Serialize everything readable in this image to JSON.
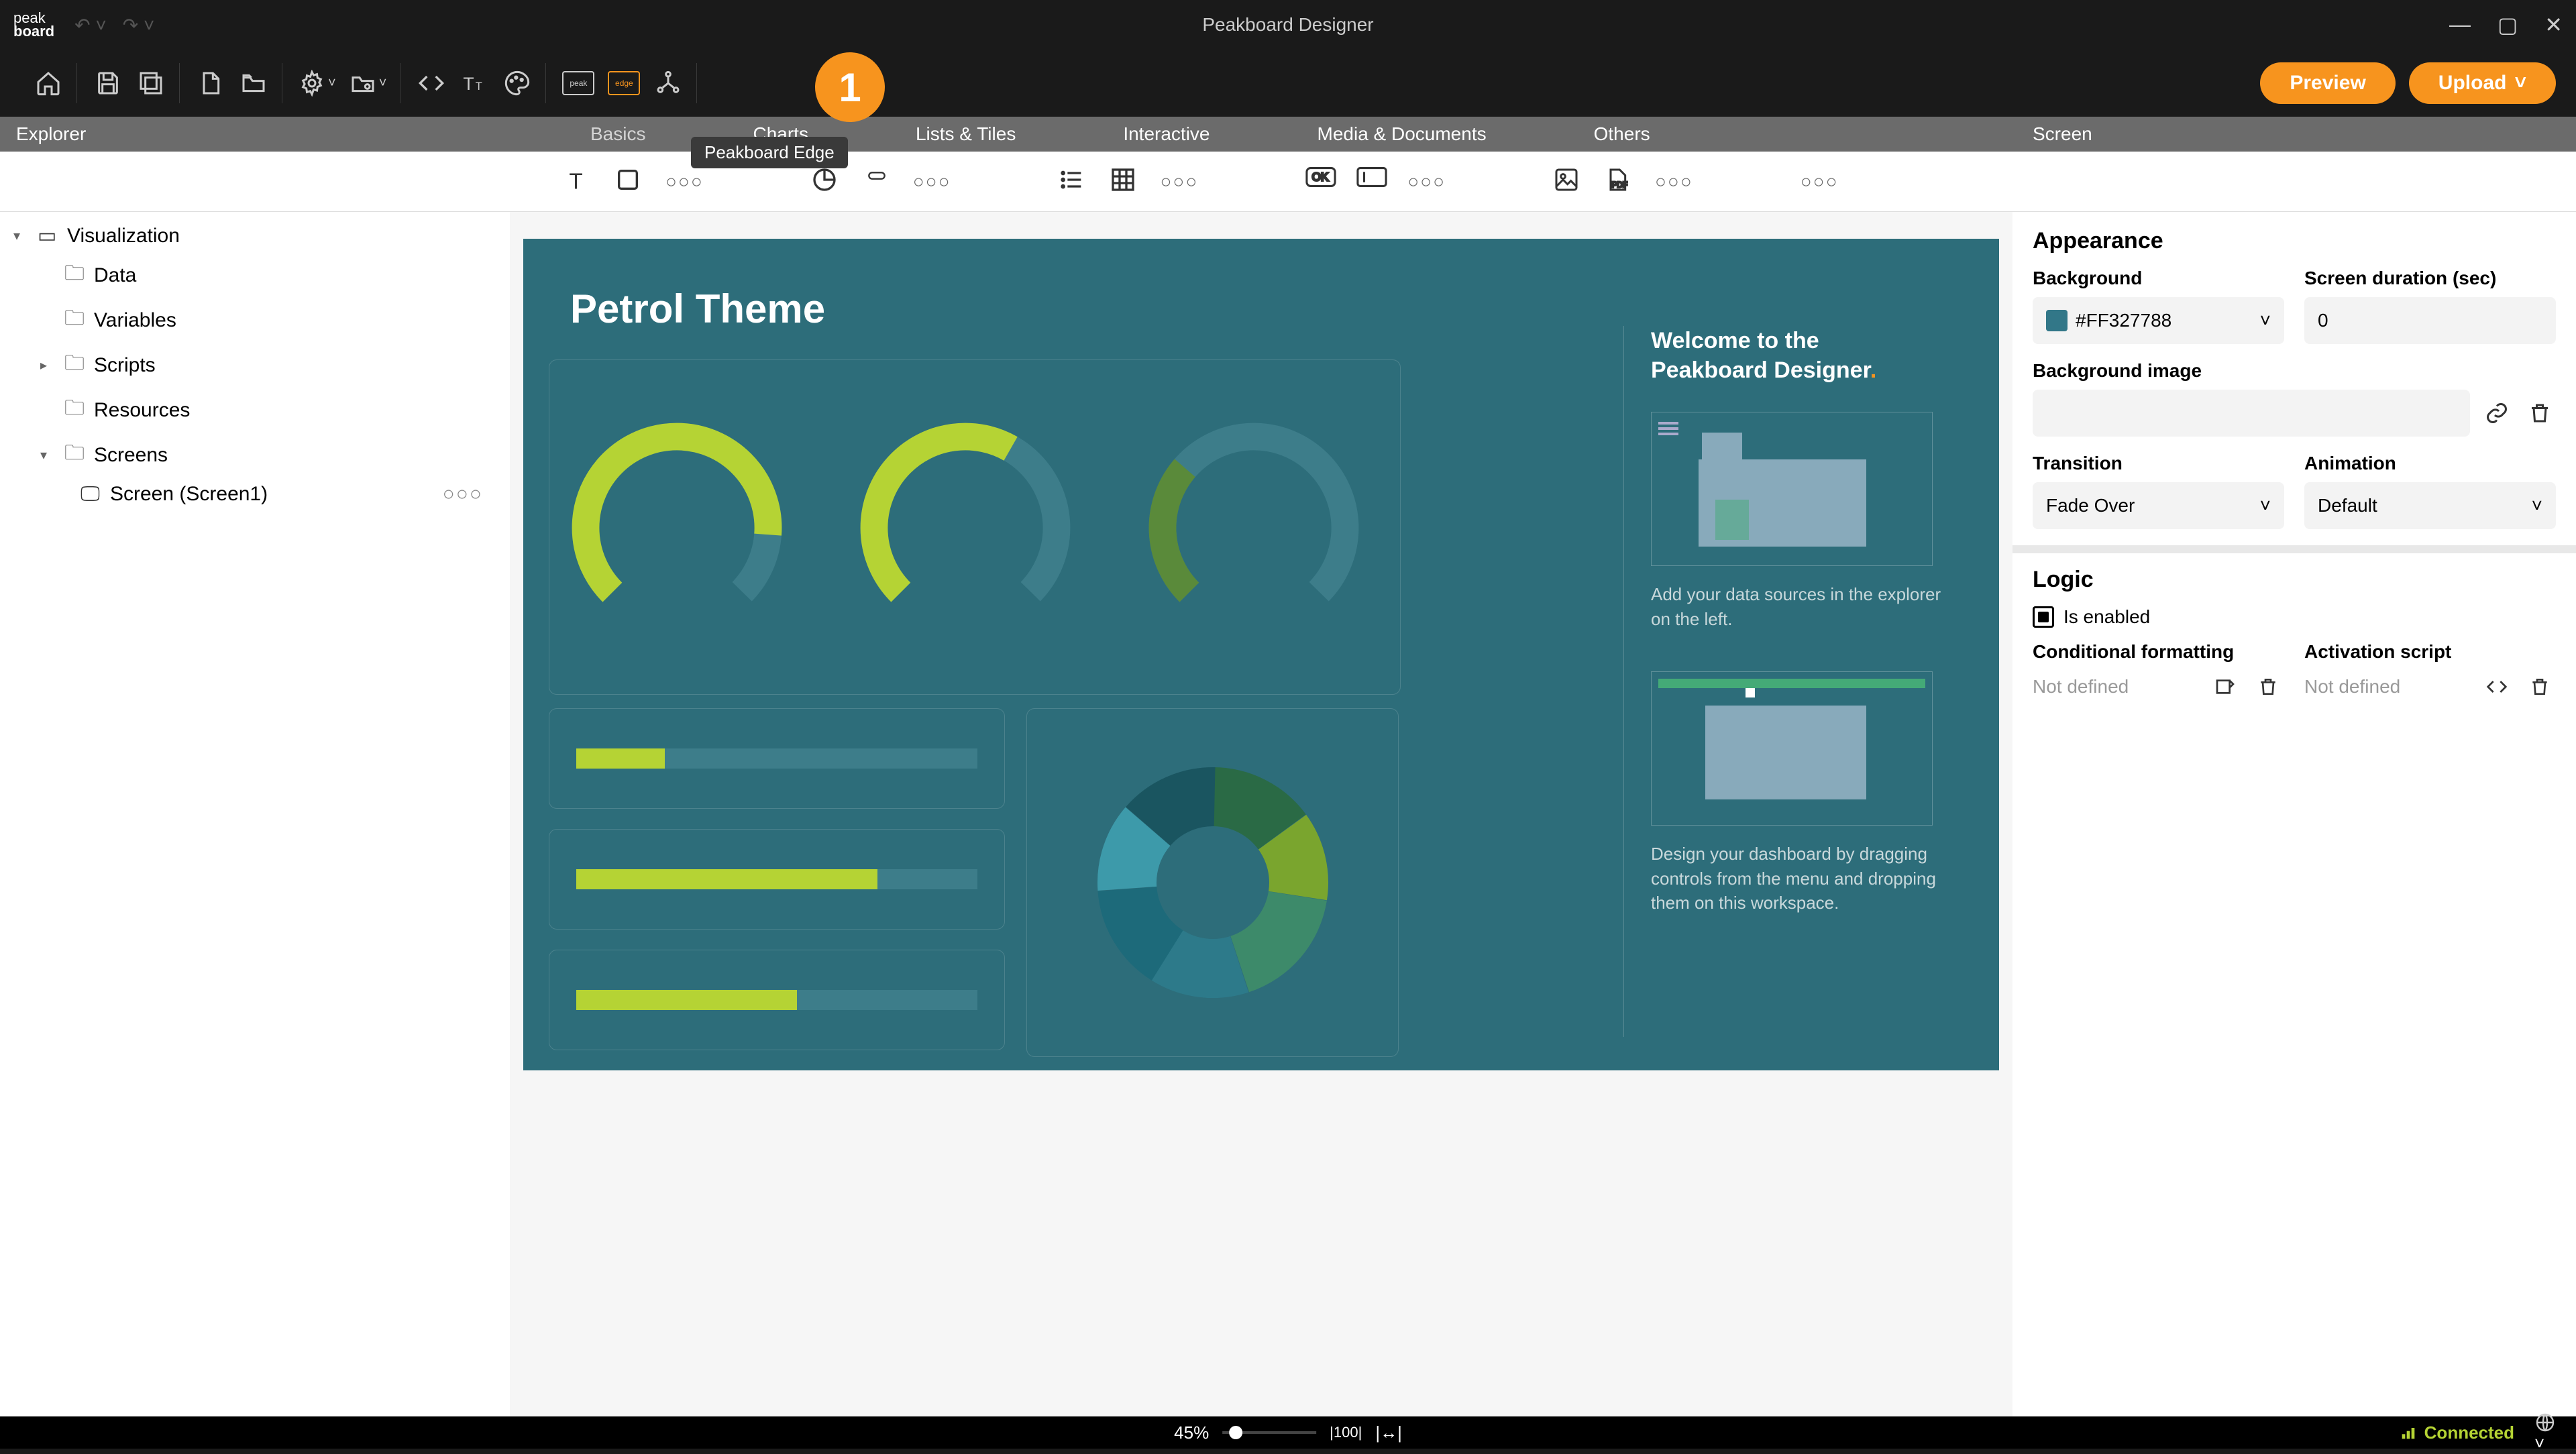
{
  "app_title": "Peakboard Designer",
  "logo": {
    "top": "peak",
    "bottom": "board"
  },
  "toolbar": {
    "preview": "Preview",
    "upload": "Upload"
  },
  "tooltip": "Peakboard Edge",
  "badge": "1",
  "panels": {
    "explorer": "Explorer",
    "screen": "Screen"
  },
  "categories": {
    "basics": "Basics",
    "charts": "Charts",
    "lists": "Lists & Tiles",
    "interactive": "Interactive",
    "media": "Media & Documents",
    "others": "Others"
  },
  "tree": {
    "root": "Visualization",
    "data": "Data",
    "variables": "Variables",
    "scripts": "Scripts",
    "resources": "Resources",
    "screens": "Screens",
    "screen1": "Screen (Screen1)"
  },
  "canvas": {
    "title": "Petrol Theme",
    "welcome_l1": "Welcome to the",
    "welcome_l2": "Peakboard Designer",
    "hint1": "Add your data sources in the explorer on the left.",
    "hint2": "Design your dashboard by dragging controls from the menu and dropping them on this workspace."
  },
  "props": {
    "appearance": "Appearance",
    "background": "Background",
    "bg_value": "#FF327788",
    "duration_label": "Screen duration (sec)",
    "duration_value": "0",
    "bg_image": "Background image",
    "transition": "Transition",
    "transition_value": "Fade Over",
    "animation": "Animation",
    "animation_value": "Default",
    "logic": "Logic",
    "is_enabled": "Is enabled",
    "cond_format": "Conditional formatting",
    "activation": "Activation script",
    "not_defined": "Not defined"
  },
  "status": {
    "zoom": "45%",
    "connected": "Connected"
  }
}
